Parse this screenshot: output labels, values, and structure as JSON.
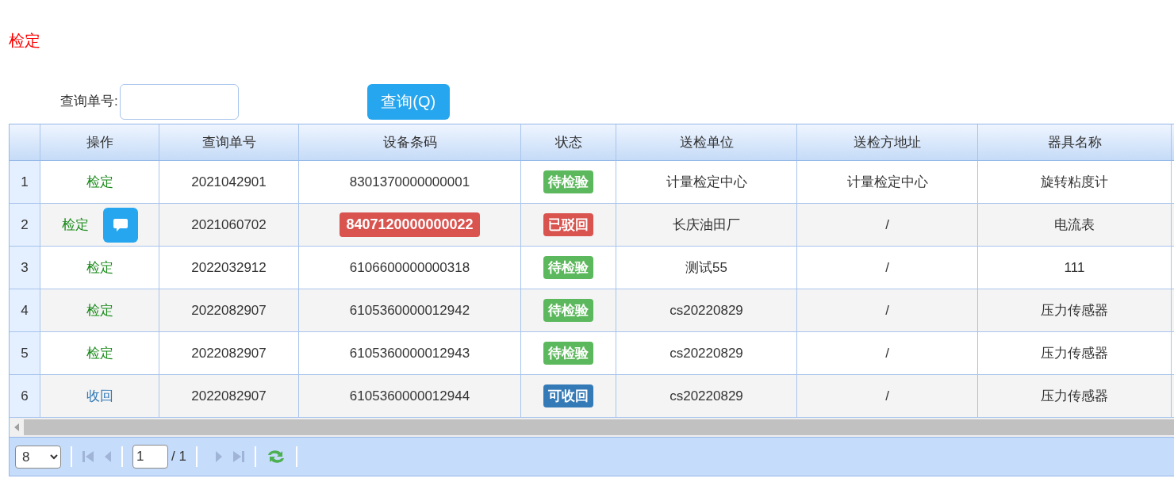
{
  "page_title": "检定",
  "search": {
    "label": "查询单号:",
    "button": "查询(Q)"
  },
  "table": {
    "columns": [
      "",
      "操作",
      "查询单号",
      "设备条码",
      "状态",
      "送检单位",
      "送检方地址",
      "器具名称"
    ],
    "rows": [
      {
        "index": "1",
        "action": {
          "label": "检定",
          "kind": "verify"
        },
        "has_message": false,
        "order_no": "2021042901",
        "barcode": "8301370000000001",
        "barcode_flagged": false,
        "status": {
          "label": "待检验",
          "color": "#5cb85c"
        },
        "unit": "计量检定中心",
        "address": "计量检定中心",
        "instrument": "旋转粘度计"
      },
      {
        "index": "2",
        "action": {
          "label": "检定",
          "kind": "verify"
        },
        "has_message": true,
        "order_no": "2021060702",
        "barcode": "8407120000000022",
        "barcode_flagged": true,
        "status": {
          "label": "已驳回",
          "color": "#d9534f"
        },
        "unit": "长庆油田厂",
        "address": "/",
        "instrument": "电流表"
      },
      {
        "index": "3",
        "action": {
          "label": "检定",
          "kind": "verify"
        },
        "has_message": false,
        "order_no": "2022032912",
        "barcode": "6106600000000318",
        "barcode_flagged": false,
        "status": {
          "label": "待检验",
          "color": "#5cb85c"
        },
        "unit": "测试55",
        "address": "/",
        "instrument": "111"
      },
      {
        "index": "4",
        "action": {
          "label": "检定",
          "kind": "verify"
        },
        "has_message": false,
        "order_no": "2022082907",
        "barcode": "6105360000012942",
        "barcode_flagged": false,
        "status": {
          "label": "待检验",
          "color": "#5cb85c"
        },
        "unit": "cs20220829",
        "address": "/",
        "instrument": "压力传感器"
      },
      {
        "index": "5",
        "action": {
          "label": "检定",
          "kind": "verify"
        },
        "has_message": false,
        "order_no": "2022082907",
        "barcode": "6105360000012943",
        "barcode_flagged": false,
        "status": {
          "label": "待检验",
          "color": "#5cb85c"
        },
        "unit": "cs20220829",
        "address": "/",
        "instrument": "压力传感器"
      },
      {
        "index": "6",
        "action": {
          "label": "收回",
          "kind": "recall"
        },
        "has_message": false,
        "order_no": "2022082907",
        "barcode": "6105360000012944",
        "barcode_flagged": false,
        "status": {
          "label": "可收回",
          "color": "#337ab7"
        },
        "unit": "cs20220829",
        "address": "/",
        "instrument": "压力传感器"
      }
    ]
  },
  "pager": {
    "page_size": "8",
    "page": "1",
    "total": "/ 1"
  }
}
